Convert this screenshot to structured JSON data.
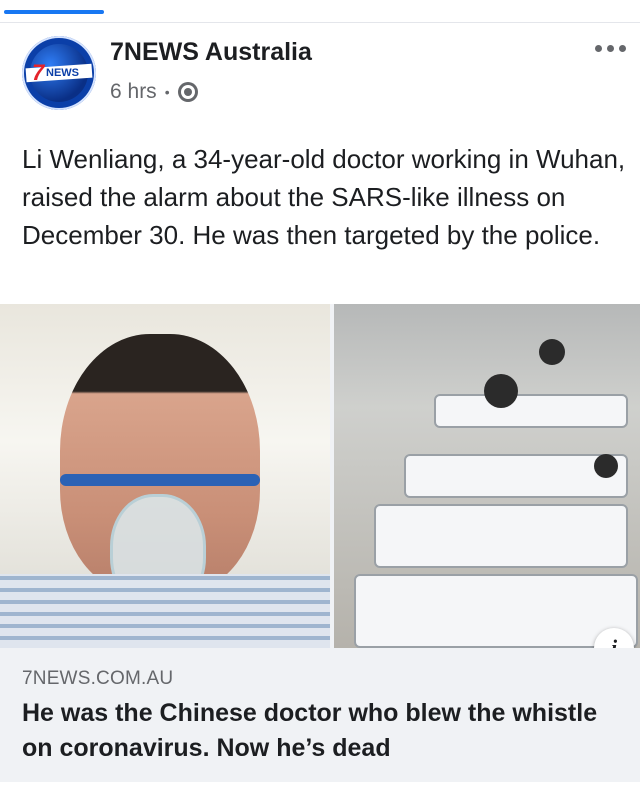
{
  "post": {
    "page_name": "7NEWS Australia",
    "time": "6 hrs",
    "separator": "•",
    "privacy_icon": "globe-icon",
    "more_icon": "more-options-icon",
    "text": "Li Wenliang, a 34-year-old doctor working in Wuhan, raised the alarm about the SARS-like illness on December 30. He was then targeted by the police."
  },
  "avatar": {
    "seven": "7",
    "label": "NEWS"
  },
  "link_preview": {
    "domain": "7NEWS.COM.AU",
    "headline": "He was the Chinese doctor who blew the whistle on coronavirus. Now he’s dead",
    "info_label": "i"
  },
  "colors": {
    "accent": "#1877f2",
    "text_primary": "#1c1e21",
    "text_secondary": "#65676b",
    "card_bg": "#f0f2f5"
  }
}
